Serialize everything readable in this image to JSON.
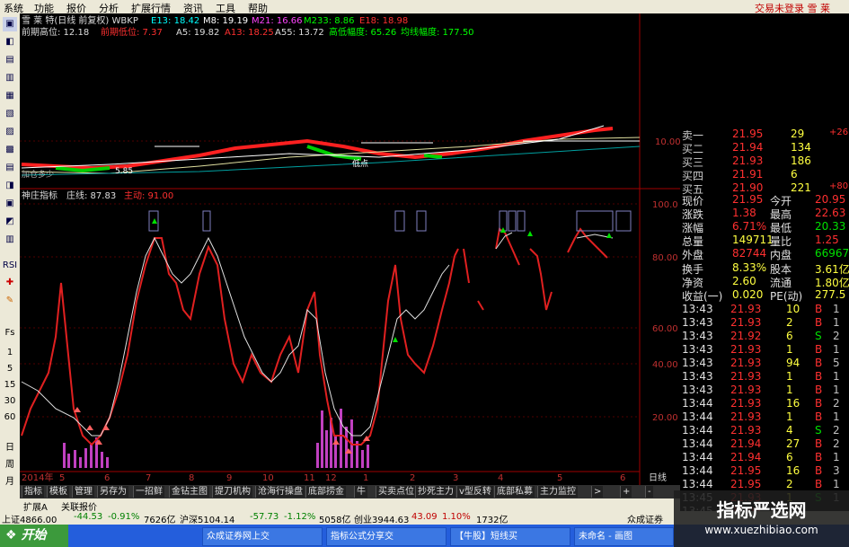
{
  "menu": [
    "系统",
    "功能",
    "报价",
    "分析",
    "扩展行情",
    "资讯",
    "工具",
    "帮助"
  ],
  "menu_right": "交易未登录  雪 莱",
  "toolbar_labels": [
    "RSI",
    "Fs",
    "日",
    "周",
    "月",
    "多"
  ],
  "header": {
    "title": "雪 莱 特(日线 前复权) WBKP",
    "e13": "E13: 18.42",
    "m8": "M8: 19.19",
    "m21": "M21: 16.66",
    "m233": "M233: 8.86",
    "e18": "E18: 18.98",
    "prev_high": "前期高位: 12.18",
    "prev_low": "前期低位: 7.37",
    "a5": "A5: 19.82",
    "a13": "A13: 18.25",
    "a55": "A55: 13.72",
    "hl_range": "高低幅度: 65.26",
    "avg_range": "均线幅度: 177.50"
  },
  "main_axis": [
    "10.00"
  ],
  "main_notes": [
    "低点",
    "5.85",
    "加仓多少"
  ],
  "indicator": {
    "name": "神庄指标",
    "line1": "庄线: 87.83",
    "line2": "主动: 91.00"
  },
  "ind_axis": [
    "100.0",
    "80.00",
    "60.00",
    "40.00",
    "20.00"
  ],
  "x_axis": [
    "2014年",
    "5",
    "6",
    "7",
    "8",
    "9",
    "10",
    "11",
    "12",
    "1",
    "2",
    "3",
    "4",
    "5",
    "6",
    "日线"
  ],
  "quote": {
    "asks": [
      {
        "l": "卖一",
        "p": "21.95",
        "v": "29",
        "c": "+26"
      },
      {
        "l": "买二",
        "p": "21.94",
        "v": "134",
        "c": ""
      },
      {
        "l": "买三",
        "p": "21.93",
        "v": "186",
        "c": ""
      },
      {
        "l": "买四",
        "p": "21.91",
        "v": "6",
        "c": ""
      },
      {
        "l": "买五",
        "p": "21.90",
        "v": "221",
        "c": "+80"
      }
    ],
    "stats": [
      [
        "现价",
        "21.95",
        "今开",
        "20.95"
      ],
      [
        "涨跌",
        "1.38",
        "最高",
        "22.63"
      ],
      [
        "涨幅",
        "6.71%",
        "最低",
        "20.33"
      ],
      [
        "总量",
        "149711",
        "量比",
        "1.25"
      ],
      [
        "外盘",
        "82744",
        "内盘",
        "66967"
      ]
    ],
    "stats2": [
      [
        "换手",
        "8.33%",
        "股本",
        "3.61亿"
      ],
      [
        "净资",
        "2.60",
        "流通",
        "1.80亿"
      ],
      [
        "收益(一)",
        "0.020",
        "PE(动)",
        "277.5"
      ]
    ],
    "ticks": [
      [
        "13:43",
        "21.93",
        "10",
        "B",
        "1"
      ],
      [
        "13:43",
        "21.93",
        "2",
        "B",
        "1"
      ],
      [
        "13:43",
        "21.92",
        "6",
        "S",
        "2"
      ],
      [
        "13:43",
        "21.93",
        "1",
        "B",
        "1"
      ],
      [
        "13:43",
        "21.93",
        "94",
        "B",
        "5"
      ],
      [
        "13:43",
        "21.93",
        "1",
        "B",
        "1"
      ],
      [
        "13:43",
        "21.93",
        "1",
        "B",
        "1"
      ],
      [
        "13:44",
        "21.93",
        "16",
        "B",
        "2"
      ],
      [
        "13:44",
        "21.93",
        "1",
        "B",
        "1"
      ],
      [
        "13:44",
        "21.93",
        "4",
        "S",
        "2"
      ],
      [
        "13:44",
        "21.94",
        "27",
        "B",
        "2"
      ],
      [
        "13:44",
        "21.94",
        "6",
        "B",
        "1"
      ],
      [
        "13:44",
        "21.95",
        "16",
        "B",
        "3"
      ],
      [
        "13:44",
        "21.95",
        "2",
        "B",
        "1"
      ],
      [
        "13:45",
        "21.93",
        "1",
        "S",
        "1"
      ],
      [
        "13:45",
        "21.95",
        "",
        "",
        ""
      ]
    ]
  },
  "tabs": [
    "指标",
    "模板",
    "管理",
    "另存为",
    "一招鲜",
    "金钻主图",
    "提刀机构",
    "沧海行操盘",
    "底部捞金",
    "牛",
    "买卖点位",
    "抄死主力",
    "v型反转",
    "底部私募",
    "主力监控",
    ">",
    "+",
    "-"
  ],
  "subtabs": [
    "扩展A",
    "关联报价"
  ],
  "indexbar": [
    "上证4866.00",
    "-44.53",
    "-0.91%",
    "7626亿",
    "沪深5104.14",
    "-57.73",
    "-1.12%",
    "5058亿",
    "创业3944.63",
    "43.09",
    "1.10%",
    "1732亿",
    "众成证券"
  ],
  "taskbar": {
    "start": "开始",
    "tasks": [
      "众成证券网上交",
      "指标公式分享交",
      "【牛股】短线买",
      "未命名 - 画图"
    ]
  },
  "watermark": {
    "cn": "指标严选网",
    "url": "www.xuezhibiao.com"
  }
}
